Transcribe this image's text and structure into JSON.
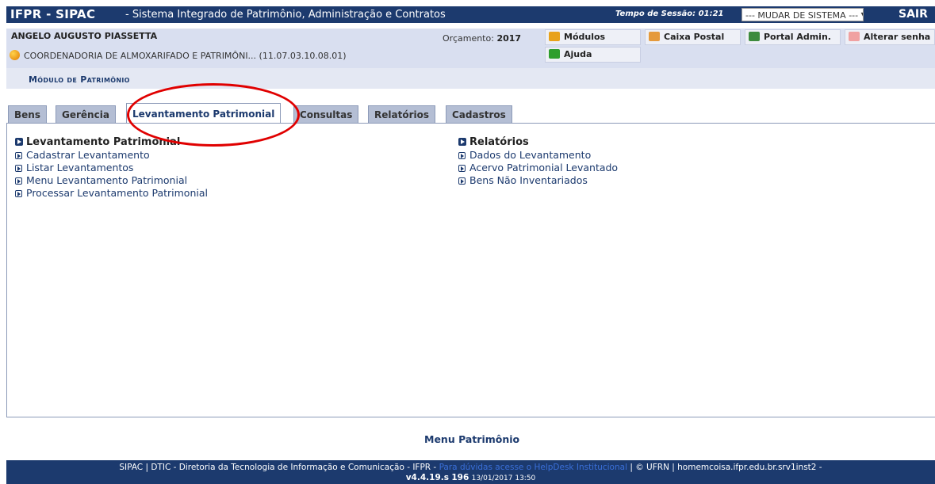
{
  "header": {
    "brand": "IFPR - SIPAC",
    "subtitle": "- Sistema Integrado de Patrimônio, Administração e Contratos",
    "session_label": "Tempo de Sessão:",
    "session_time": "01:21",
    "system_select": "--- MUDAR DE SISTEMA --- ▼",
    "sair": "SAIR"
  },
  "user": {
    "name": "ANGELO AUGUSTO PIASSETTA",
    "department": "COORDENADORIA DE ALMOXARIFADO E PATRIMÔNI... (11.07.03.10.08.01)",
    "orcamento_label": "Orçamento:",
    "orcamento_year": "2017"
  },
  "shortcuts": {
    "modulos": "Módulos",
    "caixa_postal": "Caixa Postal",
    "portal_admin": "Portal Admin.",
    "alterar_senha": "Alterar senha",
    "ajuda": "Ajuda"
  },
  "module_title": "Módulo de Patrimônio",
  "tabs": [
    {
      "label": "Bens"
    },
    {
      "label": "Gerência"
    },
    {
      "label": "Levantamento Patrimonial"
    },
    {
      "label": "Consultas"
    },
    {
      "label": "Relatórios"
    },
    {
      "label": "Cadastros"
    }
  ],
  "active_tab": "Levantamento Patrimonial",
  "sections": {
    "left": {
      "title": "Levantamento Patrimonial",
      "items": [
        "Cadastrar Levantamento",
        "Listar Levantamentos",
        "Menu Levantamento Patrimonial",
        "Processar Levantamento Patrimonial"
      ]
    },
    "right": {
      "title": "Relatórios",
      "items": [
        "Dados do Levantamento",
        "Acervo Patrimonial Levantado",
        "Bens Não Inventariados"
      ]
    }
  },
  "menu_link": "Menu Patrimônio",
  "footer": {
    "line1_a": "SIPAC | DTIC - Diretoria da Tecnologia de Informação e Comunicação - IFPR -",
    "help": "Para dúvidas acesse o HelpDesk Institucional",
    "line1_b": "| © UFRN | homemcoisa.ifpr.edu.br.srv1inst2 -",
    "version": "v4.4.19.s",
    "build": "196",
    "timestamp": "13/01/2017 13:50"
  },
  "colors": {
    "brand": "#1c3a6e",
    "highlight_circle": "#e00000"
  }
}
